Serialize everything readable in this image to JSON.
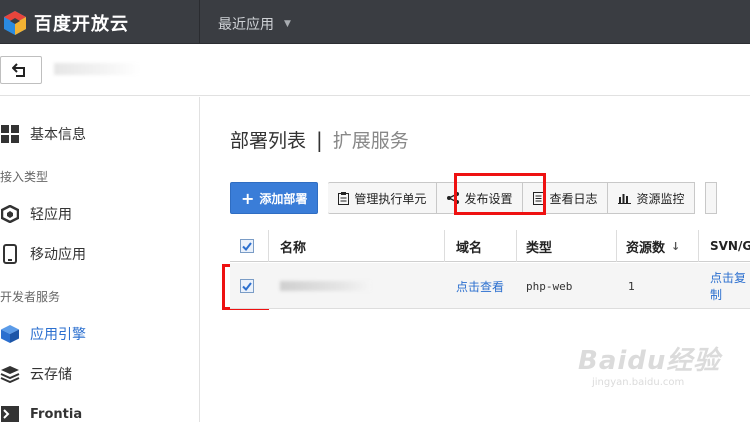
{
  "topbar": {
    "logo_text": "百度开放云",
    "recent_label": "最近应用"
  },
  "sidebar": {
    "items": [
      {
        "label": "基本信息",
        "icon": "grid-icon"
      },
      {
        "label": "轻应用",
        "icon": "cube-icon"
      },
      {
        "label": "移动应用",
        "icon": "phone-icon"
      },
      {
        "label": "应用引擎",
        "icon": "engine-cube-icon",
        "active": true
      },
      {
        "label": "云存储",
        "icon": "layers-icon"
      },
      {
        "label": "Frontia",
        "icon": "terminal-icon"
      }
    ],
    "groups": [
      "接入类型",
      "开发者服务"
    ]
  },
  "main": {
    "title": "部署列表",
    "title_sep": "|",
    "subtitle": "扩展服务"
  },
  "toolbar": {
    "add_label": "添加部署",
    "manage_label": "管理执行单元",
    "publish_label": "发布设置",
    "logs_label": "查看日志",
    "monitor_label": "资源监控"
  },
  "table": {
    "headers": [
      "名称",
      "域名",
      "类型",
      "资源数",
      "SVN/G"
    ],
    "rows": [
      {
        "domain": "点击查看",
        "type": "php-web",
        "resources": "1",
        "repo": "点击复制"
      }
    ]
  },
  "watermark": {
    "main": "Baidu经验",
    "sub": "jingyan.baidu.com"
  },
  "colors": {
    "accent": "#3a7dd8",
    "highlight": "#e11111",
    "topbar": "#3a3d42"
  }
}
